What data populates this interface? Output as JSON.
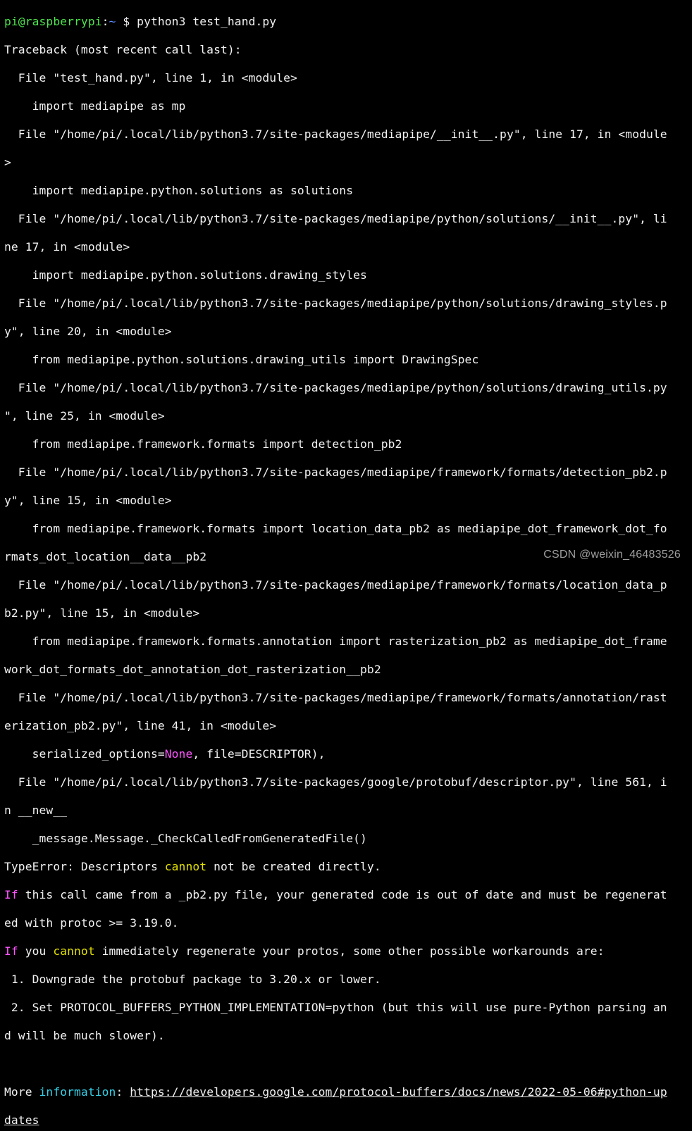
{
  "prompt": {
    "user_host": "pi@raspberrypi",
    "sep": ":",
    "cwd": "~",
    "symbol": " $ ",
    "command": "python3 test_hand.py"
  },
  "output": {
    "l02": "Traceback (most recent call last):",
    "l03": "  File \"test_hand.py\", line 1, in <module>",
    "l04": "    import mediapipe as mp",
    "l05": "  File \"/home/pi/.local/lib/python3.7/site-packages/mediapipe/__init__.py\", line 17, in <module",
    "l06": ">",
    "l07": "    import mediapipe.python.solutions as solutions",
    "l08": "  File \"/home/pi/.local/lib/python3.7/site-packages/mediapipe/python/solutions/__init__.py\", li",
    "l09": "ne 17, in <module>",
    "l10": "    import mediapipe.python.solutions.drawing_styles",
    "l11": "  File \"/home/pi/.local/lib/python3.7/site-packages/mediapipe/python/solutions/drawing_styles.p",
    "l12": "y\", line 20, in <module>",
    "l13": "    from mediapipe.python.solutions.drawing_utils import DrawingSpec",
    "l14": "  File \"/home/pi/.local/lib/python3.7/site-packages/mediapipe/python/solutions/drawing_utils.py",
    "l15": "\", line 25, in <module>",
    "l16": "    from mediapipe.framework.formats import detection_pb2",
    "l17": "  File \"/home/pi/.local/lib/python3.7/site-packages/mediapipe/framework/formats/detection_pb2.p",
    "l18": "y\", line 15, in <module>",
    "l19": "    from mediapipe.framework.formats import location_data_pb2 as mediapipe_dot_framework_dot_fo",
    "l20": "rmats_dot_location__data__pb2",
    "l21": "  File \"/home/pi/.local/lib/python3.7/site-packages/mediapipe/framework/formats/location_data_p",
    "l22": "b2.py\", line 15, in <module>",
    "l23": "    from mediapipe.framework.formats.annotation import rasterization_pb2 as mediapipe_dot_frame",
    "l24": "work_dot_formats_dot_annotation_dot_rasterization__pb2",
    "l25": "  File \"/home/pi/.local/lib/python3.7/site-packages/mediapipe/framework/formats/annotation/rast",
    "l26": "erization_pb2.py\", line 41, in <module>",
    "l27a": "    serialized_options=",
    "l27b": "None",
    "l27c": ", file=DESCRIPTOR),",
    "l28": "  File \"/home/pi/.local/lib/python3.7/site-packages/google/protobuf/descriptor.py\", line 561, i",
    "l29": "n __new__",
    "l30": "    _message.Message._CheckCalledFromGeneratedFile()",
    "l31a": "TypeError: Descriptors ",
    "l31b": "cannot",
    "l31c": " not be created directly.",
    "l32a": "If",
    "l32b": " this call came from a _pb2.py file, your generated code is out of date and must be regenerat",
    "l33": "ed with protoc >= 3.19.0.",
    "l34a": "If",
    "l34b": " you ",
    "l34c": "cannot",
    "l34d": " immediately regenerate your protos, some other possible workarounds are:",
    "l35": " 1. Downgrade the protobuf package to 3.20.x or lower.",
    "l36": " 2. Set PROTOCOL_BUFFERS_PYTHON_IMPLEMENTATION=python (but this will use pure-Python parsing an",
    "l37": "d will be much slower).",
    "l38": "",
    "l39a": "More ",
    "l39b": "information",
    "l39c": ": ",
    "l39d": "https://developers.google.com/protocol-buffers/docs/news/2022-05-06#python-up",
    "l40": "dates"
  },
  "watermark": "CSDN @weixin_46483526"
}
